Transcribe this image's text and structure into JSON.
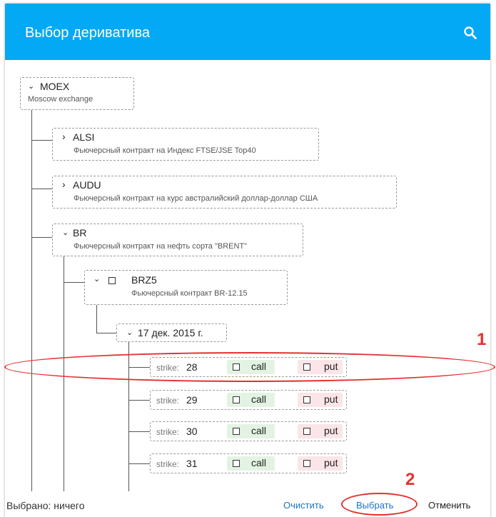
{
  "dialog": {
    "title": "Выбор дериватива",
    "search_icon": "search-icon"
  },
  "colors": {
    "header": "#03a9f4",
    "accent_link": "#1a73c8",
    "annotation": "#e53030",
    "call_bg": "#e3f3e3",
    "put_bg": "#fbe5e8"
  },
  "tree": {
    "root": {
      "title": "MOEX",
      "description": "Moscow exchange",
      "expanded": true
    },
    "children": [
      {
        "title": "ALSI",
        "description": "Фьючерсный контракт на Индекс FTSE/JSE Top40",
        "expanded": false
      },
      {
        "title": "AUDU",
        "description": "Фьючерсный контракт на курс австралийский доллар-доллар США",
        "expanded": false
      },
      {
        "title": "BR",
        "description": "Фьючерсный контракт на нефть сорта \"BRENT\"",
        "expanded": true
      }
    ],
    "contract": {
      "title": "BRZ5",
      "description": "Фьючерсный контракт BR-12.15",
      "expanded": true,
      "checked": false
    },
    "expiration": {
      "title": "17 дек. 2015 г.",
      "expanded": true
    },
    "strike_label": "strike:",
    "call_label": "call",
    "put_label": "put",
    "strikes": [
      {
        "value": "28",
        "call_checked": false,
        "put_checked": false
      },
      {
        "value": "29",
        "call_checked": false,
        "put_checked": false
      },
      {
        "value": "30",
        "call_checked": false,
        "put_checked": false
      },
      {
        "value": "31",
        "call_checked": false,
        "put_checked": false
      }
    ]
  },
  "footer": {
    "status": "Выбрано: ничего",
    "clear_label": "Очистить",
    "select_label": "Выбрать",
    "cancel_label": "Отменить"
  },
  "annotations": {
    "marker1": "1",
    "marker2": "2"
  }
}
